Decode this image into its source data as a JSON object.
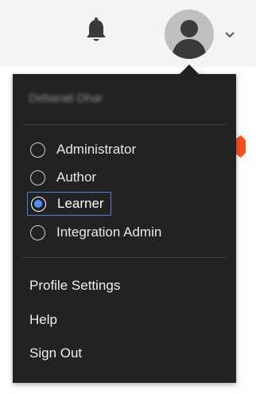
{
  "header": {
    "bell_icon": "bell-icon",
    "avatar_icon": "user-avatar-icon",
    "chevron_icon": "chevron-down-icon"
  },
  "menu": {
    "username": "Debarati Dhar",
    "roles": [
      {
        "label": "Administrator",
        "selected": false
      },
      {
        "label": "Author",
        "selected": false
      },
      {
        "label": "Learner",
        "selected": true
      },
      {
        "label": "Integration Admin",
        "selected": false
      }
    ],
    "links": [
      {
        "label": "Profile Settings"
      },
      {
        "label": "Help"
      },
      {
        "label": "Sign Out"
      }
    ]
  },
  "colors": {
    "menu_bg": "#222222",
    "header_bg": "#f4f4f4",
    "selected_outline": "#4f7fd6",
    "radio_dot": "#4f8ff7",
    "accent": "#f4511e"
  }
}
